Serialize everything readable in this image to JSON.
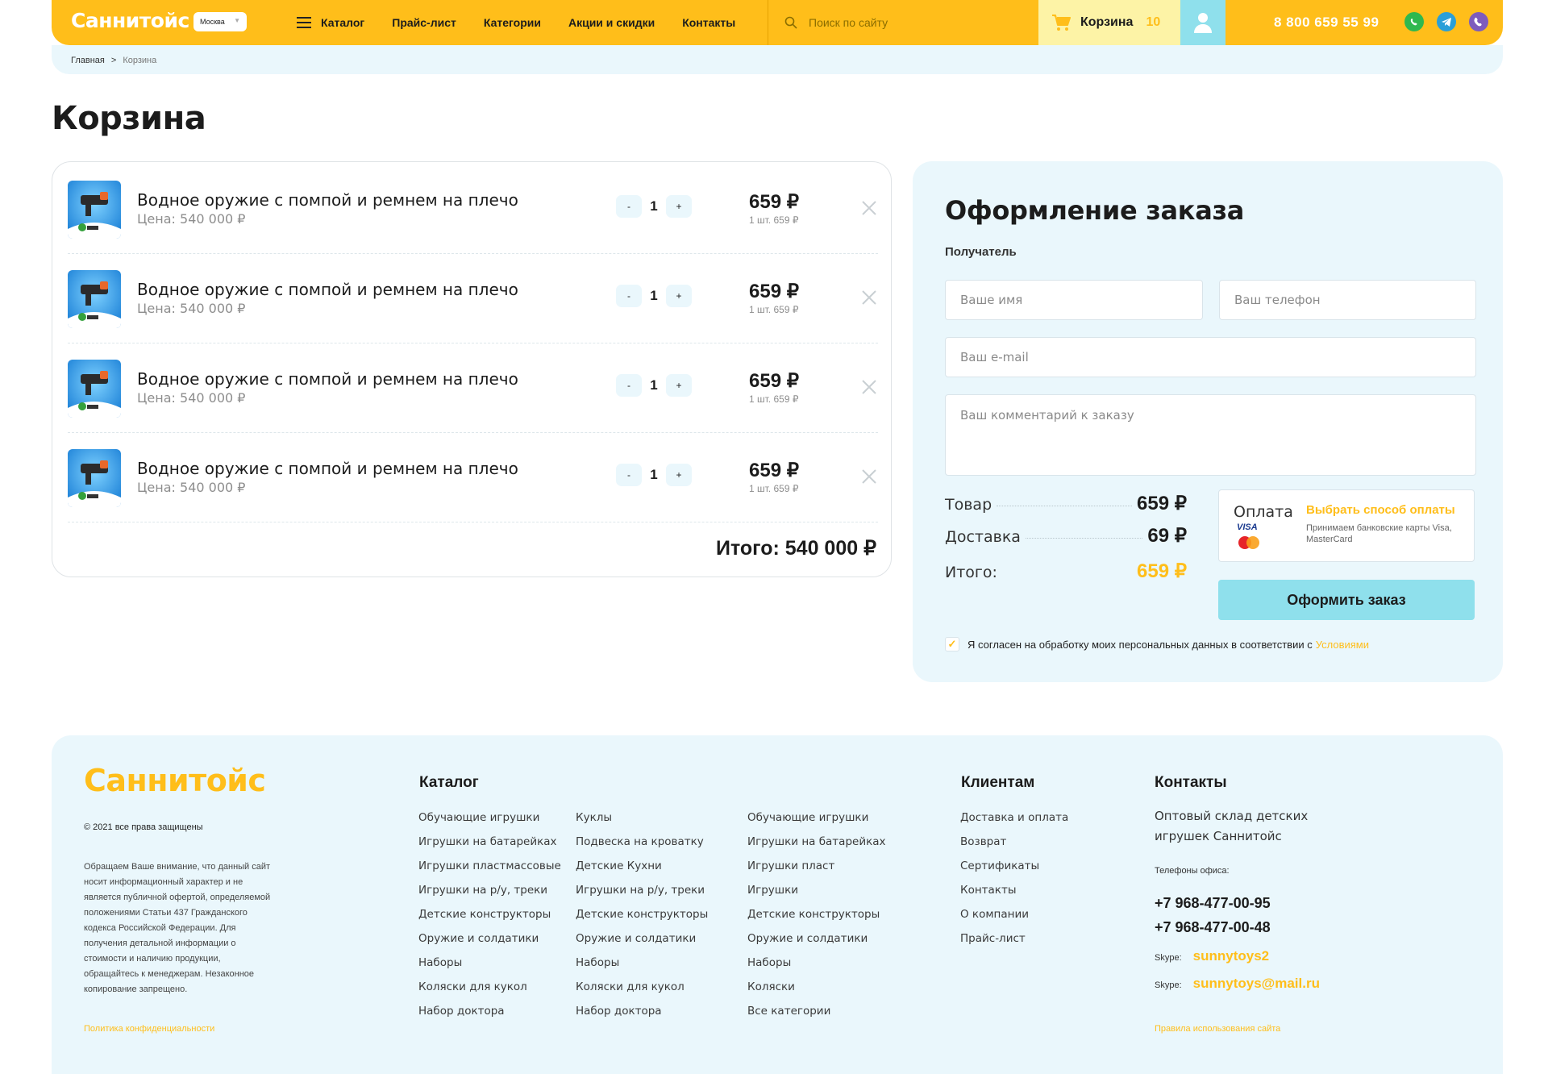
{
  "header": {
    "logo": "Саннитойс",
    "city": "Москва",
    "nav": [
      "Каталог",
      "Прайс-лист",
      "Категории",
      "Акции и скидки",
      "Контакты"
    ],
    "search_placeholder": "Поиск по сайту",
    "cart_label": "Корзина",
    "cart_count": "10",
    "phone": "8 800 659 55 99"
  },
  "breadcrumb": {
    "home": "Главная",
    "separator": ">",
    "current": "Корзина"
  },
  "page_title": "Корзина",
  "cart": {
    "items": [
      {
        "name": "Водное оружие с помпой и ремнем на плечо",
        "price_label": "Цена: 540 000 ₽",
        "qty": "1",
        "line_price": "659 ₽",
        "unit_price": "1 шт. 659 ₽"
      },
      {
        "name": "Водное оружие с помпой и ремнем на плечо",
        "price_label": "Цена: 540 000 ₽",
        "qty": "1",
        "line_price": "659 ₽",
        "unit_price": "1 шт. 659 ₽"
      },
      {
        "name": "Водное оружие с помпой и ремнем на плечо",
        "price_label": "Цена: 540 000 ₽",
        "qty": "1",
        "line_price": "659 ₽",
        "unit_price": "1 шт. 659 ₽"
      },
      {
        "name": "Водное оружие с помпой и ремнем на плечо",
        "price_label": "Цена: 540 000 ₽",
        "qty": "1",
        "line_price": "659 ₽",
        "unit_price": "1 шт. 659 ₽"
      }
    ],
    "minus": "-",
    "plus": "+",
    "total": "Итого: 540 000 ₽"
  },
  "order": {
    "title": "Оформление заказа",
    "recipient": "Получатель",
    "name_placeholder": "Ваше имя",
    "phone_placeholder": "Ваш телефон",
    "email_placeholder": "Ваш e-mail",
    "comment_placeholder": "Ваш комментарий к заказу",
    "summary": {
      "goods_label": "Товар",
      "goods_value": "659 ₽",
      "delivery_label": "Доставка",
      "delivery_value": "69 ₽",
      "total_label": "Итого:",
      "total_value": "659 ₽"
    },
    "payment": {
      "label": "Оплата",
      "choose": "Выбрать способ оплаты",
      "note": "Принимаем банковские карты Visa, MasterCard",
      "visa": "VISA"
    },
    "submit": "Оформить заказ",
    "agree_text": "Я согласен на обработку моих персональных данных в соответствии с",
    "agree_link": "Условиями"
  },
  "footer": {
    "logo": "Саннитойс",
    "copyright": "© 2021 все права защищены",
    "disclaimer": "Обращаем Ваше внимание, что данный сайт носит информационный характер и не является публичной офертой, определяемой положениями Статьи 437 Гражданского кодекса Российской Федерации. Для получения детальной информации о стоимости и наличию продукции, обращайтесь к менеджерам. Незаконное копирование запрещено.",
    "privacy": "Политика конфиденциальности",
    "catalog_title": "Каталог",
    "catalog_col1": [
      "Обучающие игрушки",
      "Игрушки на батарейках",
      "Игрушки пластмассовые",
      "Игрушки на р/у, треки",
      "Детские конструкторы",
      "Оружие и солдатики",
      "Наборы",
      "Коляски для кукол",
      "Набор доктора"
    ],
    "catalog_col2": [
      "Куклы",
      "Подвеска на кроватку",
      "Детские Кухни",
      "Игрушки на р/у, треки",
      "Детские конструкторы",
      "Оружие и солдатики",
      "Наборы",
      "Коляски для кукол",
      "Набор доктора"
    ],
    "catalog_col3": [
      "Обучающие игрушки",
      "Игрушки на батарейках",
      "Игрушки пласт",
      "Игрушки",
      "Детские конструкторы",
      "Оружие и солдатики",
      "Наборы",
      "Коляски",
      "Все категории"
    ],
    "clients_title": "Клиентам",
    "clients": [
      "Доставка и оплата",
      "Возврат",
      "Сертификаты",
      "Контакты",
      "О компании",
      "Прайс-лист"
    ],
    "contacts_title": "Контакты",
    "contacts_desc": "Оптовый склад детских игрушек Саннитойс",
    "phones_label": "Телефоны офиса:",
    "phone1": "+7 968-477-00-95",
    "phone2": "+7 968-477-00-48",
    "skype_label": "Skype:",
    "skype1": "sunnytoys2",
    "skype2": "sunnytoys@mail.ru",
    "rules": "Правила использования сайта"
  },
  "colors": {
    "accent": "#ffbe1a",
    "light_blue": "#eaf7fc",
    "cyan": "#8fe0ec"
  }
}
